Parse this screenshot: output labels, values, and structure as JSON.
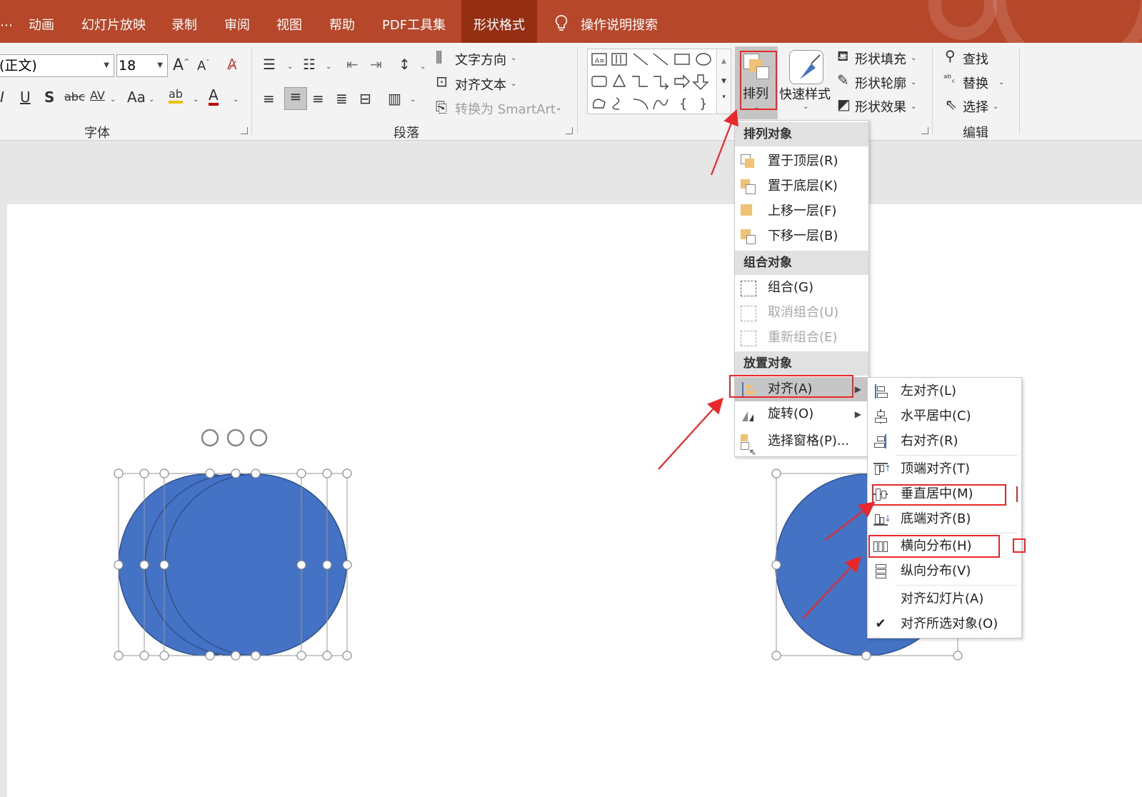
{
  "tabs": [
    "动画",
    "幻灯片放映",
    "录制",
    "审阅",
    "视图",
    "帮助",
    "PDF工具集",
    "形状格式"
  ],
  "active_tab": "形状格式",
  "tell_me": "操作说明搜索",
  "font": {
    "name_value": "(正文)",
    "size_value": "18",
    "group_label": "字体"
  },
  "paragraph": {
    "text_direction": "文字方向",
    "align_text": "对齐文本",
    "convert_smartart": "转换为 SmartArt",
    "group_label": "段落"
  },
  "drawing": {
    "arrange": "排列",
    "quick_styles": "快速样式",
    "shape_fill": "形状填充",
    "shape_outline": "形状轮廓",
    "shape_effects": "形状效果"
  },
  "editing": {
    "find": "查找",
    "replace": "替换",
    "select": "选择",
    "group_label": "编辑"
  },
  "arrange_menu": {
    "head_order": "排列对象",
    "bring_front": "置于顶层(R)",
    "send_back": "置于底层(K)",
    "bring_forward": "上移一层(F)",
    "send_backward": "下移一层(B)",
    "head_group": "组合对象",
    "group": "组合(G)",
    "ungroup": "取消组合(U)",
    "regroup": "重新组合(E)",
    "head_position": "放置对象",
    "align": "对齐(A)",
    "rotate": "旋转(O)",
    "selection_pane": "选择窗格(P)..."
  },
  "align_menu": {
    "left": "左对齐(L)",
    "center_h": "水平居中(C)",
    "right": "右对齐(R)",
    "top": "顶端对齐(T)",
    "middle_v": "垂直居中(M)",
    "bottom": "底端对齐(B)",
    "distribute_h": "横向分布(H)",
    "distribute_v": "纵向分布(V)",
    "align_slide": "对齐幻灯片(A)",
    "align_selected": "对齐所选对象(O)"
  },
  "colors": {
    "tab_bar": "#b7472a",
    "shape_fill": "#4472c4",
    "annotation": "#e8282b"
  }
}
